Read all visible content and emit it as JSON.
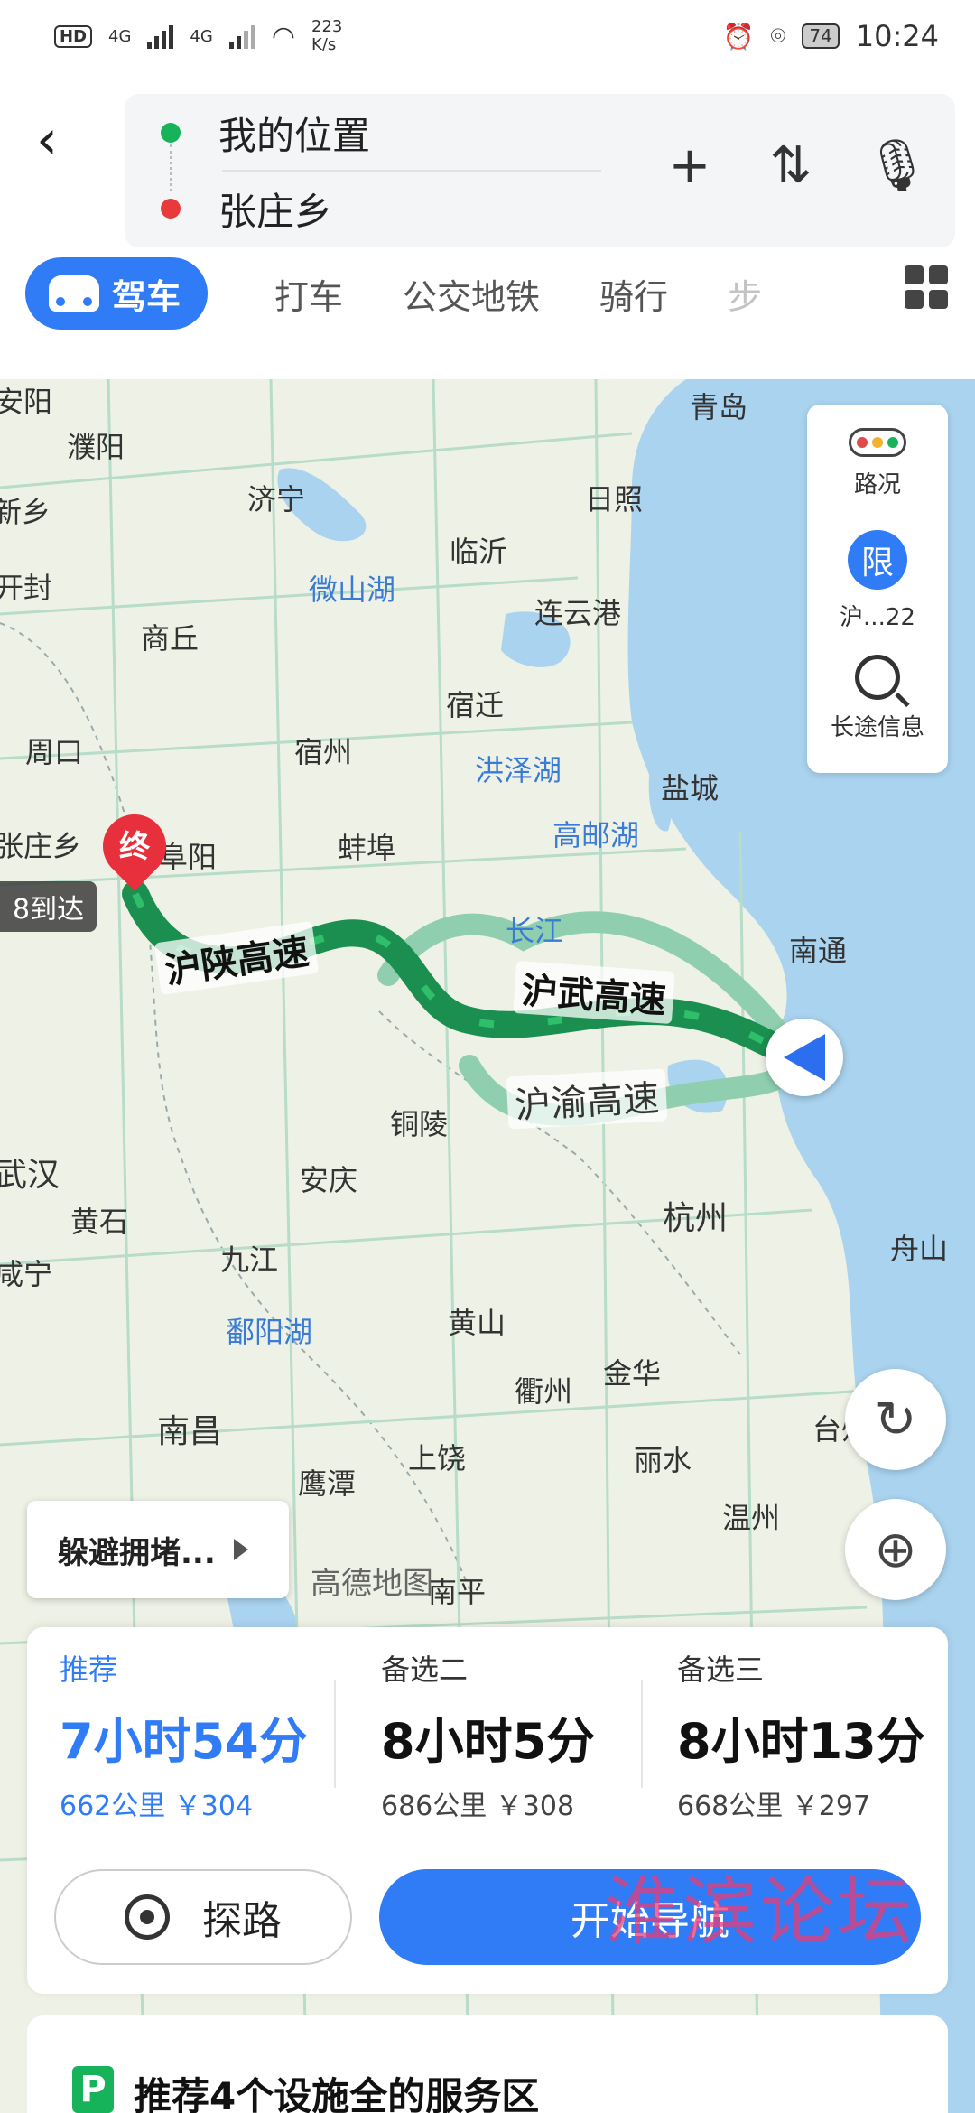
{
  "status_bar": {
    "hd": "HD",
    "sim1": "4G",
    "sim2": "4G",
    "speed_value": "223",
    "speed_unit": "K/s",
    "battery": "74",
    "time": "10:24"
  },
  "route_input": {
    "origin": "我的位置",
    "destination": "张庄乡"
  },
  "tabs": [
    {
      "label": "驾车",
      "active": true
    },
    {
      "label": "打车"
    },
    {
      "label": "公交地铁"
    },
    {
      "label": "骑行"
    },
    {
      "label": "步"
    }
  ],
  "map": {
    "cities": [
      {
        "name": "安阳"
      },
      {
        "name": "濮阳"
      },
      {
        "name": "新乡"
      },
      {
        "name": "济宁"
      },
      {
        "name": "日照"
      },
      {
        "name": "青岛"
      },
      {
        "name": "临沂"
      },
      {
        "name": "开封"
      },
      {
        "name": "微山湖"
      },
      {
        "name": "连云港"
      },
      {
        "name": "商丘"
      },
      {
        "name": "宿迁"
      },
      {
        "name": "周口"
      },
      {
        "name": "宿州"
      },
      {
        "name": "洪泽湖"
      },
      {
        "name": "盐城"
      },
      {
        "name": "张庄乡"
      },
      {
        "name": "阜阳"
      },
      {
        "name": "蚌埠"
      },
      {
        "name": "高邮湖"
      },
      {
        "name": "长江"
      },
      {
        "name": "南通"
      },
      {
        "name": "铜陵"
      },
      {
        "name": "武汉"
      },
      {
        "name": "安庆"
      },
      {
        "name": "黄石"
      },
      {
        "name": "杭州"
      },
      {
        "name": "舟山"
      },
      {
        "name": "九江"
      },
      {
        "name": "咸宁"
      },
      {
        "name": "黄山"
      },
      {
        "name": "鄱阳湖"
      },
      {
        "name": "金华"
      },
      {
        "name": "衢州"
      },
      {
        "name": "南昌"
      },
      {
        "name": "丽水"
      },
      {
        "name": "上饶"
      },
      {
        "name": "台州"
      },
      {
        "name": "鹰潭"
      },
      {
        "name": "温州"
      },
      {
        "name": "南平"
      }
    ],
    "routes": {
      "main_1": "沪陕高速",
      "main_2": "沪武高速",
      "alt_1": "沪渝高速"
    },
    "end_pin": "终",
    "end_tag": "8到达",
    "watermark": "高德地图"
  },
  "side_panel": {
    "traffic": "路况",
    "limit_icon": "限",
    "limit_text": "沪...22",
    "long_trip": "长途信息"
  },
  "avoid_congestion": "躲避拥堵...",
  "route_options": [
    {
      "label": "推荐",
      "time": "7小时54分",
      "distance": "662公里",
      "cost": "￥304"
    },
    {
      "label": "备选二",
      "time": "8小时5分",
      "distance": "686公里",
      "cost": "￥308"
    },
    {
      "label": "备选三",
      "time": "8小时13分",
      "distance": "668公里",
      "cost": "￥297"
    }
  ],
  "buttons": {
    "probe": "探路",
    "start_nav": "开始导航"
  },
  "overlay_brand": "淮滨论坛",
  "service_area": {
    "icon": "P",
    "text": "推荐4个设施全的服务区"
  },
  "colors": {
    "accent": "#2f7cf6",
    "route_main": "#1b8f4f",
    "route_alt": "#8fcfb0",
    "origin_dot": "#17b35b",
    "dest_dot": "#e83a3a"
  }
}
